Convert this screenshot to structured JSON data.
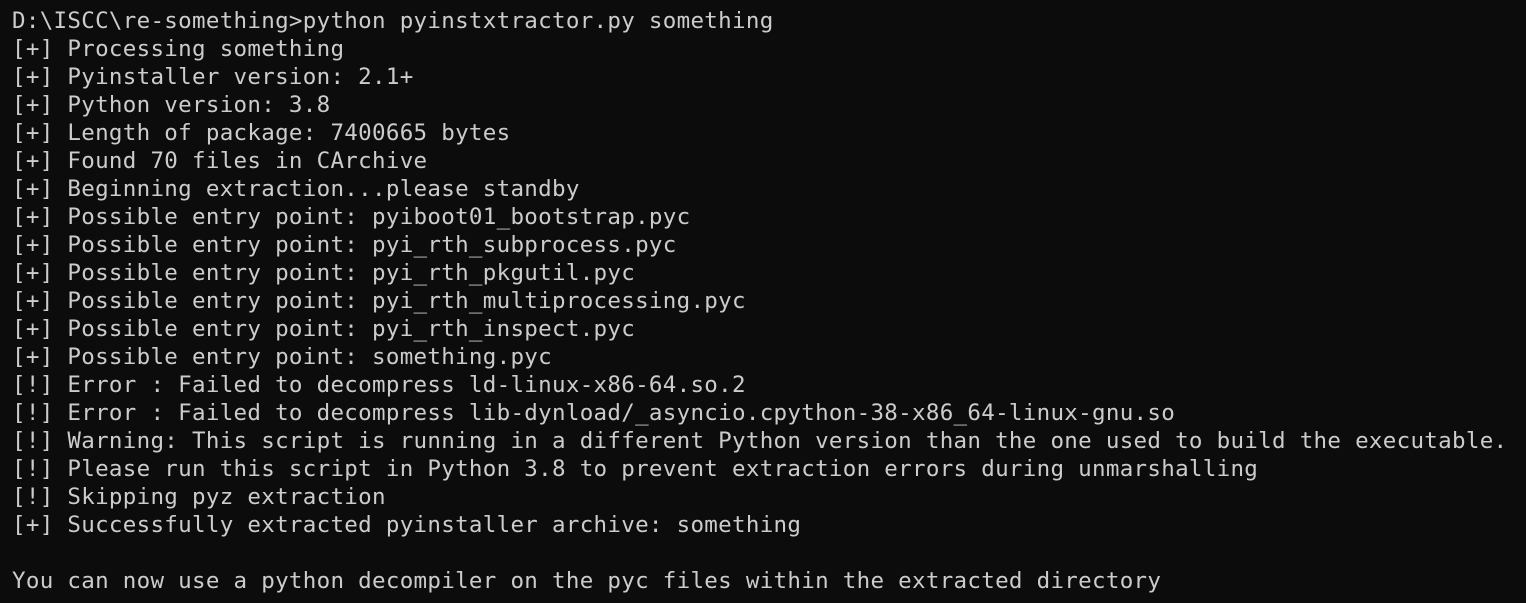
{
  "terminal": {
    "lines": [
      "D:\\ISCC\\re-something>python pyinstxtractor.py something",
      "[+] Processing something",
      "[+] Pyinstaller version: 2.1+",
      "[+] Python version: 3.8",
      "[+] Length of package: 7400665 bytes",
      "[+] Found 70 files in CArchive",
      "[+] Beginning extraction...please standby",
      "[+] Possible entry point: pyiboot01_bootstrap.pyc",
      "[+] Possible entry point: pyi_rth_subprocess.pyc",
      "[+] Possible entry point: pyi_rth_pkgutil.pyc",
      "[+] Possible entry point: pyi_rth_multiprocessing.pyc",
      "[+] Possible entry point: pyi_rth_inspect.pyc",
      "[+] Possible entry point: something.pyc",
      "[!] Error : Failed to decompress ld-linux-x86-64.so.2",
      "[!] Error : Failed to decompress lib-dynload/_asyncio.cpython-38-x86_64-linux-gnu.so",
      "[!] Warning: This script is running in a different Python version than the one used to build the executable.",
      "[!] Please run this script in Python 3.8 to prevent extraction errors during unmarshalling",
      "[!] Skipping pyz extraction",
      "[+] Successfully extracted pyinstaller archive: something",
      "",
      "You can now use a python decompiler on the pyc files within the extracted directory"
    ]
  }
}
